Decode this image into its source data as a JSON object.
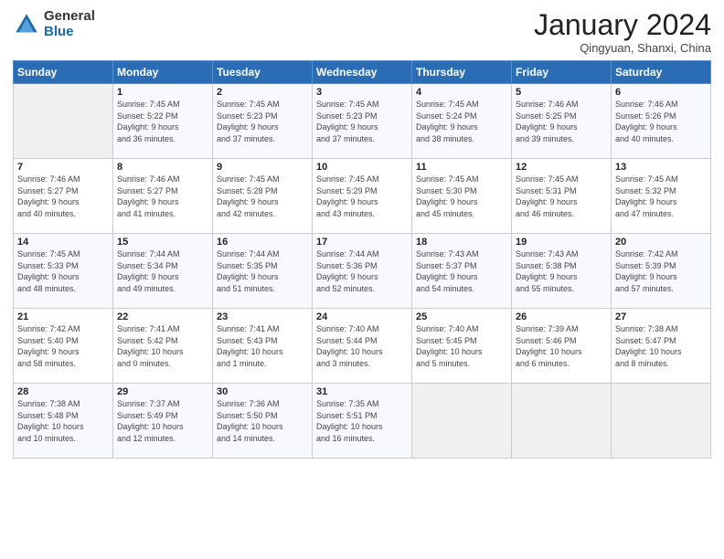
{
  "logo": {
    "general": "General",
    "blue": "Blue"
  },
  "header": {
    "title": "January 2024",
    "subtitle": "Qingyuan, Shanxi, China"
  },
  "columns": [
    "Sunday",
    "Monday",
    "Tuesday",
    "Wednesday",
    "Thursday",
    "Friday",
    "Saturday"
  ],
  "weeks": [
    [
      {
        "day": "",
        "info": ""
      },
      {
        "day": "1",
        "info": "Sunrise: 7:45 AM\nSunset: 5:22 PM\nDaylight: 9 hours\nand 36 minutes."
      },
      {
        "day": "2",
        "info": "Sunrise: 7:45 AM\nSunset: 5:23 PM\nDaylight: 9 hours\nand 37 minutes."
      },
      {
        "day": "3",
        "info": "Sunrise: 7:45 AM\nSunset: 5:23 PM\nDaylight: 9 hours\nand 37 minutes."
      },
      {
        "day": "4",
        "info": "Sunrise: 7:45 AM\nSunset: 5:24 PM\nDaylight: 9 hours\nand 38 minutes."
      },
      {
        "day": "5",
        "info": "Sunrise: 7:46 AM\nSunset: 5:25 PM\nDaylight: 9 hours\nand 39 minutes."
      },
      {
        "day": "6",
        "info": "Sunrise: 7:46 AM\nSunset: 5:26 PM\nDaylight: 9 hours\nand 40 minutes."
      }
    ],
    [
      {
        "day": "7",
        "info": "Sunrise: 7:46 AM\nSunset: 5:27 PM\nDaylight: 9 hours\nand 40 minutes."
      },
      {
        "day": "8",
        "info": "Sunrise: 7:46 AM\nSunset: 5:27 PM\nDaylight: 9 hours\nand 41 minutes."
      },
      {
        "day": "9",
        "info": "Sunrise: 7:45 AM\nSunset: 5:28 PM\nDaylight: 9 hours\nand 42 minutes."
      },
      {
        "day": "10",
        "info": "Sunrise: 7:45 AM\nSunset: 5:29 PM\nDaylight: 9 hours\nand 43 minutes."
      },
      {
        "day": "11",
        "info": "Sunrise: 7:45 AM\nSunset: 5:30 PM\nDaylight: 9 hours\nand 45 minutes."
      },
      {
        "day": "12",
        "info": "Sunrise: 7:45 AM\nSunset: 5:31 PM\nDaylight: 9 hours\nand 46 minutes."
      },
      {
        "day": "13",
        "info": "Sunrise: 7:45 AM\nSunset: 5:32 PM\nDaylight: 9 hours\nand 47 minutes."
      }
    ],
    [
      {
        "day": "14",
        "info": "Sunrise: 7:45 AM\nSunset: 5:33 PM\nDaylight: 9 hours\nand 48 minutes."
      },
      {
        "day": "15",
        "info": "Sunrise: 7:44 AM\nSunset: 5:34 PM\nDaylight: 9 hours\nand 49 minutes."
      },
      {
        "day": "16",
        "info": "Sunrise: 7:44 AM\nSunset: 5:35 PM\nDaylight: 9 hours\nand 51 minutes."
      },
      {
        "day": "17",
        "info": "Sunrise: 7:44 AM\nSunset: 5:36 PM\nDaylight: 9 hours\nand 52 minutes."
      },
      {
        "day": "18",
        "info": "Sunrise: 7:43 AM\nSunset: 5:37 PM\nDaylight: 9 hours\nand 54 minutes."
      },
      {
        "day": "19",
        "info": "Sunrise: 7:43 AM\nSunset: 5:38 PM\nDaylight: 9 hours\nand 55 minutes."
      },
      {
        "day": "20",
        "info": "Sunrise: 7:42 AM\nSunset: 5:39 PM\nDaylight: 9 hours\nand 57 minutes."
      }
    ],
    [
      {
        "day": "21",
        "info": "Sunrise: 7:42 AM\nSunset: 5:40 PM\nDaylight: 9 hours\nand 58 minutes."
      },
      {
        "day": "22",
        "info": "Sunrise: 7:41 AM\nSunset: 5:42 PM\nDaylight: 10 hours\nand 0 minutes."
      },
      {
        "day": "23",
        "info": "Sunrise: 7:41 AM\nSunset: 5:43 PM\nDaylight: 10 hours\nand 1 minute."
      },
      {
        "day": "24",
        "info": "Sunrise: 7:40 AM\nSunset: 5:44 PM\nDaylight: 10 hours\nand 3 minutes."
      },
      {
        "day": "25",
        "info": "Sunrise: 7:40 AM\nSunset: 5:45 PM\nDaylight: 10 hours\nand 5 minutes."
      },
      {
        "day": "26",
        "info": "Sunrise: 7:39 AM\nSunset: 5:46 PM\nDaylight: 10 hours\nand 6 minutes."
      },
      {
        "day": "27",
        "info": "Sunrise: 7:38 AM\nSunset: 5:47 PM\nDaylight: 10 hours\nand 8 minutes."
      }
    ],
    [
      {
        "day": "28",
        "info": "Sunrise: 7:38 AM\nSunset: 5:48 PM\nDaylight: 10 hours\nand 10 minutes."
      },
      {
        "day": "29",
        "info": "Sunrise: 7:37 AM\nSunset: 5:49 PM\nDaylight: 10 hours\nand 12 minutes."
      },
      {
        "day": "30",
        "info": "Sunrise: 7:36 AM\nSunset: 5:50 PM\nDaylight: 10 hours\nand 14 minutes."
      },
      {
        "day": "31",
        "info": "Sunrise: 7:35 AM\nSunset: 5:51 PM\nDaylight: 10 hours\nand 16 minutes."
      },
      {
        "day": "",
        "info": ""
      },
      {
        "day": "",
        "info": ""
      },
      {
        "day": "",
        "info": ""
      }
    ]
  ]
}
